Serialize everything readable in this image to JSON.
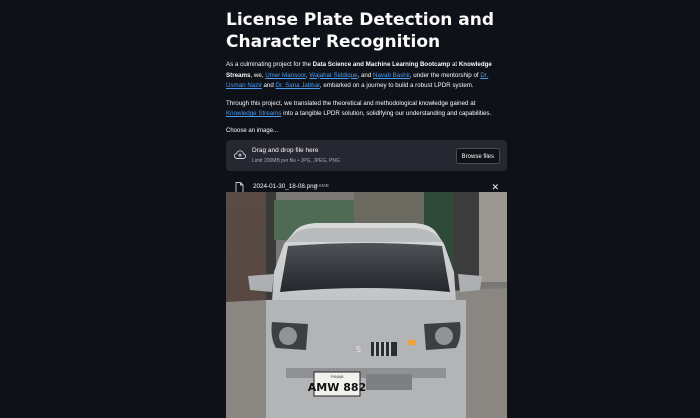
{
  "page": {
    "title": "License Plate Detection and Character Recognition",
    "intro": {
      "t1": "As a culminating project for the ",
      "b1": "Data Science and Machine Learning Bootcamp",
      "t2": " at ",
      "b2": "Knowledge Streams",
      "t3": ", we, ",
      "l1": "Umer Mansoor",
      "t4": ", ",
      "l2": "Wajahat Siddique",
      "t5": ", and ",
      "l3": "Navab Bashir",
      "t6": ", under the mentorship of ",
      "l4": "Dr. Usman Nazir",
      "t7": " and ",
      "l5": "Dr. Sana Jabbar",
      "t8": ", embarked on a journey to build a robust LPDR system."
    },
    "summary": {
      "t1": "Through this project, we translated the theoretical and methodological knowledge gained at ",
      "l1": "Knowledge Streams",
      "t2": " into a tangible LPDR solution, solidifying our understanding and capabilities."
    }
  },
  "uploader": {
    "label": "Choose an image...",
    "drop_text": "Drag and drop file here",
    "limit_text": "Limit 200MB per file • JPG, JPEG, PNG",
    "browse_label": "Browse files"
  },
  "file": {
    "name": "2024-01-30_18-08.png",
    "size": "0.6MB",
    "remove_glyph": "✕"
  },
  "image": {
    "plate_top": "PUNJAB",
    "plate_text": "AMW 882"
  }
}
